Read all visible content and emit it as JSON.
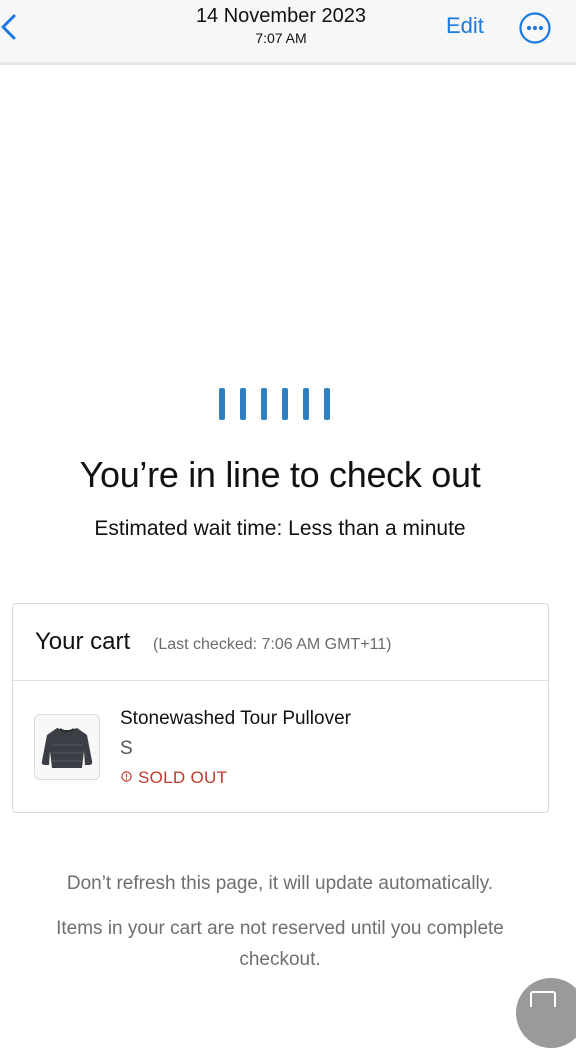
{
  "nav": {
    "date": "14 November 2023",
    "time": "7:07 AM",
    "edit_label": "Edit",
    "back_icon": "chevron-left-icon",
    "more_icon": "ellipsis-circle-icon",
    "accent_color": "#1a7ae0"
  },
  "queue": {
    "loader_icon": "loading-bars-icon",
    "loader_bar_count": 6,
    "loader_color": "#2f7fc1",
    "headline": "You’re in line to check out",
    "wait_text": "Estimated wait time: Less than a minute"
  },
  "cart": {
    "title": "Your cart",
    "last_checked": "(Last checked: 7:06 AM GMT+11)",
    "items": [
      {
        "name": "Stonewashed Tour Pullover",
        "size": "S",
        "status": "SOLD OUT",
        "status_icon": "alert-circle-icon",
        "status_color": "#c0392b",
        "image": "pullover-thumbnail"
      }
    ]
  },
  "notes": {
    "refresh": "Don’t refresh this page, it will update automatically.",
    "reserved": "Items in your cart are not reserved until you complete checkout."
  },
  "floating": {
    "icon": "screenshot-tool-icon"
  }
}
